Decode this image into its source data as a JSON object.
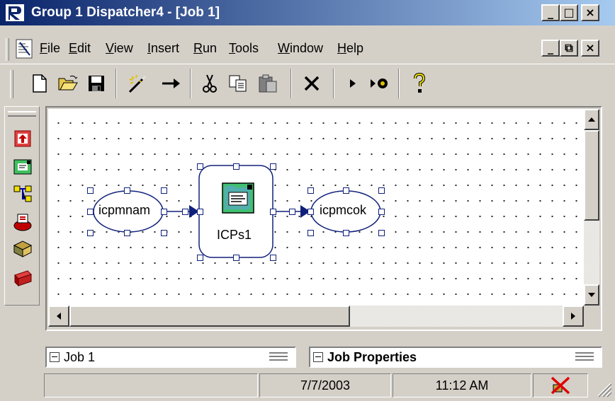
{
  "window": {
    "title": "Group 1 Dispatcher4 - [Job 1]",
    "controls": {
      "minimize": "_",
      "maximize": "□",
      "close": "×"
    }
  },
  "menubar": {
    "items": [
      {
        "label": "File",
        "accel": "F",
        "rest": "ile"
      },
      {
        "label": "Edit",
        "accel": "E",
        "rest": "dit"
      },
      {
        "label": "View",
        "accel": "V",
        "rest": "iew"
      },
      {
        "label": "Insert",
        "accel": "I",
        "rest": "nsert"
      },
      {
        "label": "Run",
        "accel": "R",
        "rest": "un"
      },
      {
        "label": "Tools",
        "accel": "T",
        "rest": "ools"
      },
      {
        "label": "Window",
        "accel": "W",
        "rest": "indow"
      },
      {
        "label": "Help",
        "accel": "H",
        "rest": "elp"
      }
    ],
    "mdi_controls": {
      "minimize": "_",
      "restore": "⧉",
      "close": "×"
    }
  },
  "toolbar": {
    "buttons": [
      "new-icon",
      "open-icon",
      "save-icon",
      "wizard-icon",
      "connect-arrow-icon",
      "cut-icon",
      "copy-icon",
      "paste-icon",
      "delete-icon",
      "run-icon",
      "run-settings-icon",
      "help-icon"
    ]
  },
  "left_toolbar": {
    "buttons": [
      "input-node-icon",
      "icp-node-icon",
      "splitter-node-icon",
      "output-node-icon",
      "storage-node-icon",
      "toolbox-node-icon"
    ]
  },
  "diagram": {
    "nodes": [
      {
        "name": "icpmnam",
        "shape": "ellipse"
      },
      {
        "name": "ICPs1",
        "shape": "rounded-box"
      },
      {
        "name": "icpmcok",
        "shape": "ellipse"
      }
    ]
  },
  "panels": {
    "job_tree_title": "Job 1",
    "properties_title": "Job Properties"
  },
  "statusbar": {
    "message": "",
    "date": "7/7/2003",
    "time": "11:12 AM",
    "status_icon": "disconnected-icon"
  },
  "colors": {
    "titlebar_start": "#0a246a",
    "titlebar_end": "#a6caf0",
    "node_border": "#10207a",
    "connector": "#10207a"
  }
}
